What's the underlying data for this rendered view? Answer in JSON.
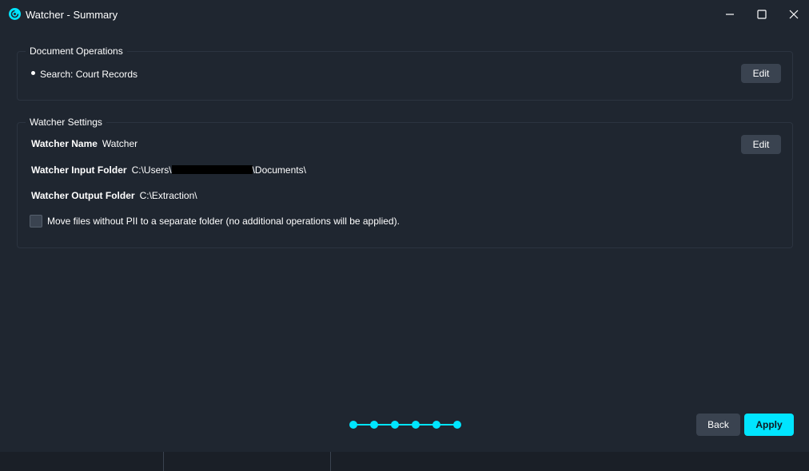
{
  "window": {
    "title": "Watcher - Summary"
  },
  "document_operations": {
    "label": "Document Operations",
    "items": [
      "Search: Court Records"
    ],
    "edit_label": "Edit"
  },
  "watcher_settings": {
    "label": "Watcher Settings",
    "edit_label": "Edit",
    "name_label": "Watcher Name",
    "name_value": "Watcher",
    "input_label": "Watcher Input Folder",
    "input_prefix": "C:\\Users\\",
    "input_suffix": "\\Documents\\",
    "output_label": "Watcher Output Folder",
    "output_value": "C:\\Extraction\\",
    "move_files_label": "Move files without PII to a separate folder (no additional operations will be applied).",
    "move_files_checked": false
  },
  "stepper": {
    "total_steps": 6,
    "current_step": 6
  },
  "footer": {
    "back_label": "Back",
    "apply_label": "Apply"
  },
  "colors": {
    "accent": "#00e5ff",
    "background": "#1f2630",
    "button": "#3a4350"
  }
}
